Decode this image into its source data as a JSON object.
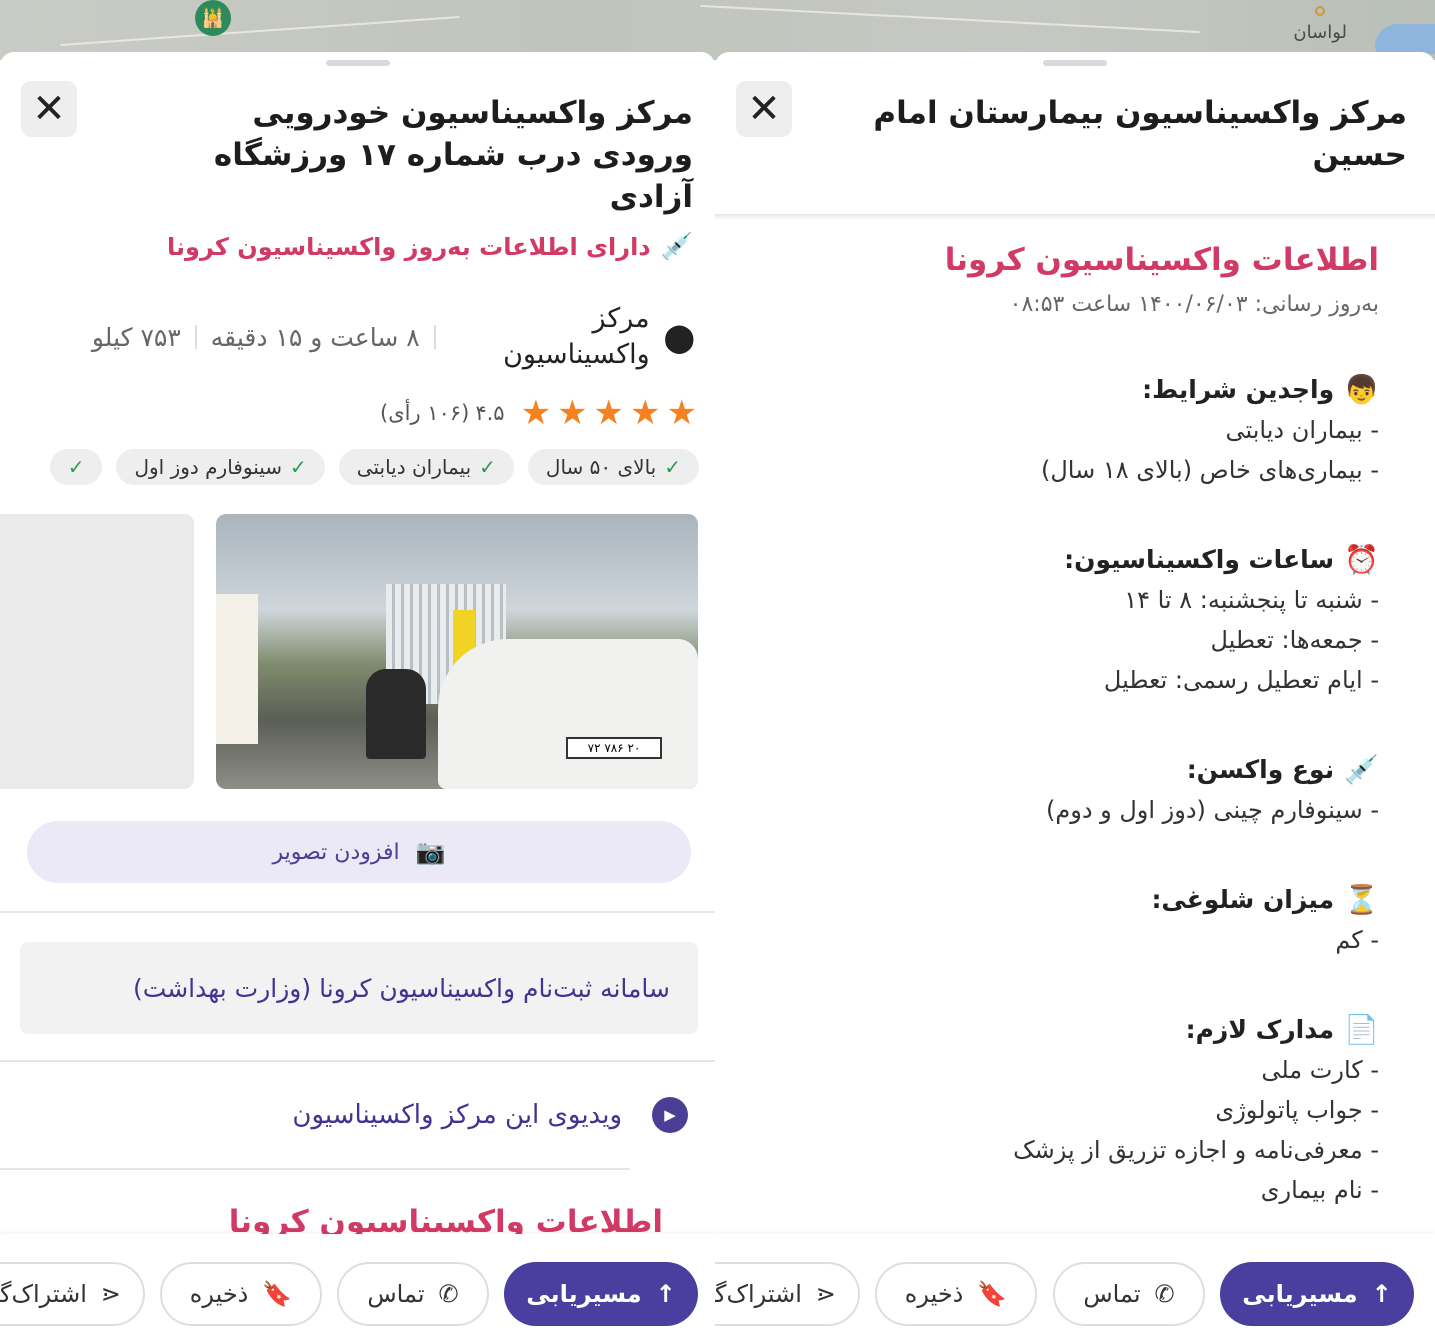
{
  "map": {
    "place_label": "لواسان"
  },
  "left": {
    "title": "مرکز واکسیناسیون خودرویی ورودی درب شماره ۱۷ ورزشگاه آزادی",
    "vaccine_tag": "دارای اطلاعات به‌روز واکسیناسیون کرونا",
    "location_name": "مرکز واکسیناسیون",
    "travel_time": "۸ ساعت و ۱۵ دقیقه",
    "distance": "۷۵۳ کیلو",
    "rating_value": "۴.۵",
    "rating_votes": "(۱۰۶ رأی)",
    "rating_stars": 5,
    "chips": [
      "بالای ۵۰ سال",
      "بیماران دیابتی",
      "سینوفارم دوز اول"
    ],
    "photo_plate": "۷۲ ۷۸۶ ۲۰",
    "add_photo_label": "افزودن تصویر",
    "registration_link": "سامانه ثبت‌نام واکسیناسیون کرونا (وزارت بهداشت)",
    "video_label": "ویدیوی این مرکز واکسیناسیون",
    "peek_heading": "اطلاعات واکسیناسیون کرونا"
  },
  "right": {
    "title": "مرکز واکسیناسیون بیمارستان امام حسین",
    "info_heading": "اطلاعات واکسیناسیون کرونا",
    "updated": "به‌روز رسانی: ۱۴۰۰/۰۶/۰۳ ساعت ۰۸:۵۳",
    "sections": {
      "eligibility": {
        "emoji": "👦",
        "title": "واجدین شرایط:",
        "lines": [
          "- بیماران دیابتی",
          "- بیماری‌های خاص (بالای ۱۸ سال)"
        ]
      },
      "hours": {
        "emoji": "⏰",
        "title": "ساعات واکسیناسیون:",
        "lines": [
          "- شنبه تا پنجشنبه: ۸ تا ۱۴",
          "- جمعه‌ها: تعطیل",
          "- ایام تعطیل رسمی: تعطیل"
        ]
      },
      "vaccine": {
        "emoji": "💉",
        "title": "نوع واکسن:",
        "lines": [
          "- سینوفارم چینی (دوز اول و دوم)"
        ]
      },
      "crowd": {
        "emoji": "⏳",
        "title": "میزان شلوغی:",
        "lines": [
          "- کم"
        ]
      },
      "docs": {
        "emoji": "📄",
        "title": "مدارک لازم:",
        "lines": [
          "- کارت ملی",
          "- جواب پاتولوژی",
          "- معرفی‌نامه و اجازه تزریق از پزشک",
          "- نام بیماری"
        ]
      }
    }
  },
  "actions": {
    "route": "مسیریابی",
    "call": "تماس",
    "save": "ذخیره",
    "share": "اشتراک‌گذاری"
  },
  "colors": {
    "accent": "#4a3f9e",
    "vaccine_red": "#d23a66",
    "star": "#f5811f",
    "check": "#2e9a52"
  }
}
